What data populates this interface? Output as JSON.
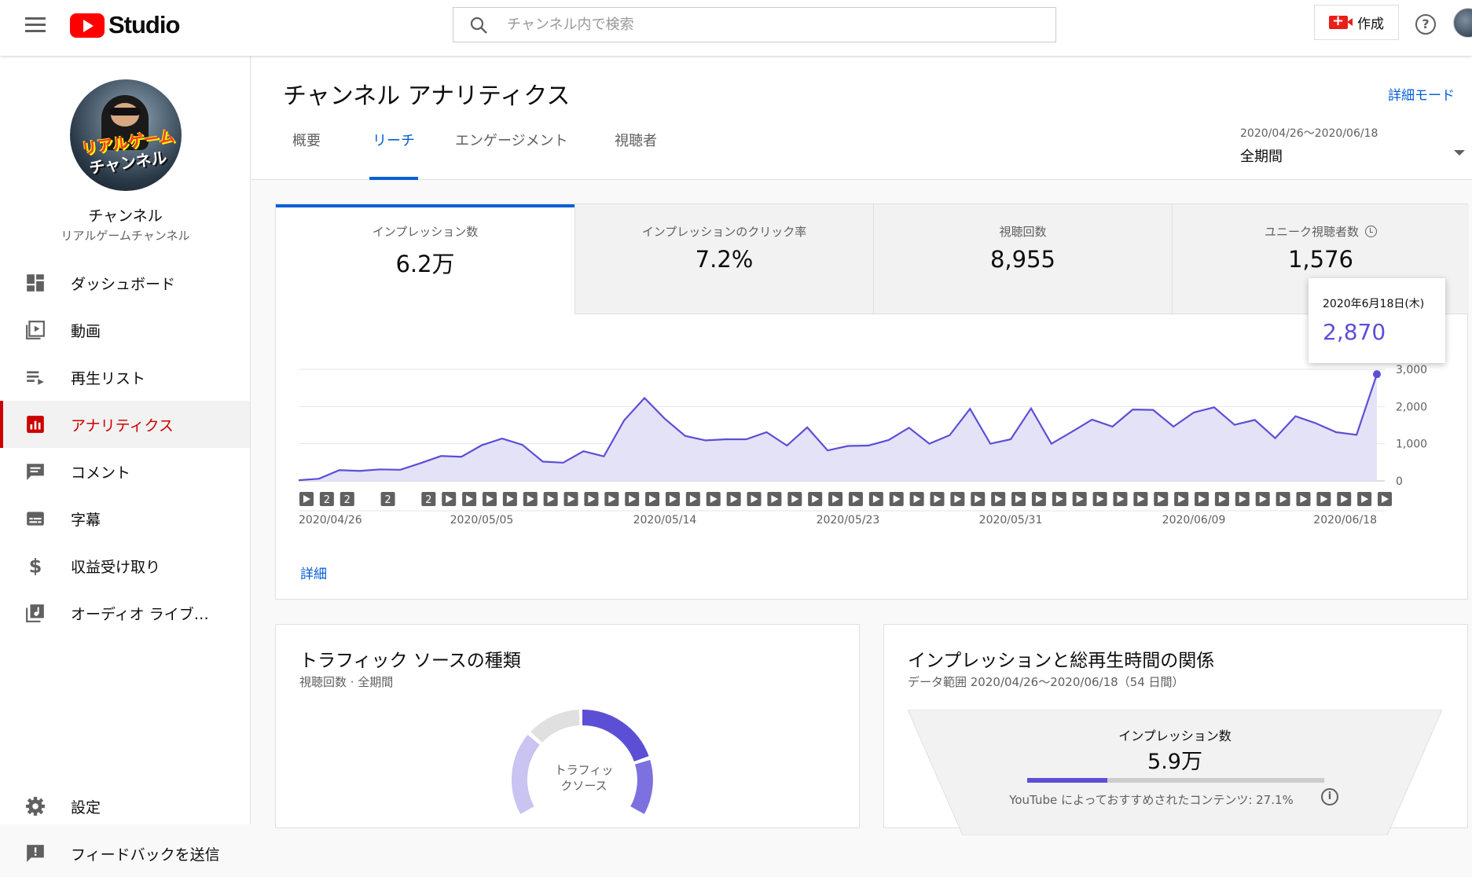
{
  "app": {
    "logo_text": "Studio",
    "logo_color": "#ff0000"
  },
  "search": {
    "placeholder": "チャンネル内で検索"
  },
  "header": {
    "create_label": "作成",
    "help_label": "?"
  },
  "channel": {
    "name": "チャンネル",
    "handle": "リアルゲームチャンネル",
    "avatar_text_1": "リアルゲーム",
    "avatar_text_2": "チャンネル"
  },
  "sidebar": {
    "items": [
      {
        "label": "ダッシュボード",
        "icon": "dashboard-icon"
      },
      {
        "label": "動画",
        "icon": "video-icon"
      },
      {
        "label": "再生リスト",
        "icon": "playlist-icon"
      },
      {
        "label": "アナリティクス",
        "icon": "analytics-icon",
        "active": true
      },
      {
        "label": "コメント",
        "icon": "comment-icon"
      },
      {
        "label": "字幕",
        "icon": "subtitles-icon"
      },
      {
        "label": "収益受け取り",
        "icon": "dollar-icon"
      },
      {
        "label": "オーディオ ライブ…",
        "icon": "audio-library-icon"
      }
    ],
    "bottom_items": [
      {
        "label": "設定",
        "icon": "gear-icon"
      },
      {
        "label": "フィードバックを送信",
        "icon": "feedback-icon"
      }
    ]
  },
  "page": {
    "title": "チャンネル アナリティクス",
    "detail_mode": "詳細モード",
    "tabs": [
      {
        "label": "概要"
      },
      {
        "label": "リーチ",
        "active": true
      },
      {
        "label": "エンゲージメント"
      },
      {
        "label": "視聴者"
      }
    ],
    "period_range": "2020/04/26〜2020/06/18",
    "period_value": "全期間"
  },
  "metrics": [
    {
      "label": "インプレッション数",
      "value": "6.2万",
      "active": true
    },
    {
      "label": "インプレッションのクリック率",
      "value": "7.2%"
    },
    {
      "label": "視聴回数",
      "value": "8,955"
    },
    {
      "label": "ユニーク視聴者数",
      "value": "1,576",
      "icon": "clock-icon"
    }
  ],
  "tooltip": {
    "date": "2020年6月18日(木)",
    "value": "2,870"
  },
  "detail_link": "詳細",
  "chart_data": {
    "type": "area",
    "x_ticks": [
      "2020/04/26",
      "2020/05/05",
      "2020/05/14",
      "2020/05/23",
      "2020/05/31",
      "2020/06/09",
      "2020/06/18"
    ],
    "y_ticks": [
      "0",
      "1,000",
      "2,000",
      "3,000"
    ],
    "ylim": [
      0,
      3000
    ],
    "grid": true,
    "color": "#5c4fd6",
    "fill": "#e4e2f7",
    "values": [
      20,
      60,
      290,
      270,
      310,
      300,
      480,
      670,
      650,
      960,
      1140,
      970,
      520,
      490,
      800,
      660,
      1630,
      2230,
      1670,
      1210,
      1090,
      1120,
      1120,
      1310,
      950,
      1440,
      820,
      940,
      950,
      1100,
      1430,
      1000,
      1230,
      1940,
      1000,
      1120,
      1950,
      1000,
      1320,
      1650,
      1460,
      1920,
      1910,
      1460,
      1840,
      1980,
      1510,
      1640,
      1150,
      1740,
      1550,
      1310,
      1240,
      2870
    ],
    "marker_labels": [
      "▶",
      "2",
      "2",
      "",
      "2",
      "",
      "2",
      "▶"
    ]
  },
  "traffic_card": {
    "title": "トラフィック ソースの種類",
    "subtitle": "視聴回数 · 全期間",
    "donut_label": "トラフィックソース"
  },
  "funnel_card": {
    "title": "インプレッションと総再生時間の関係",
    "subtitle": "データ範囲 2020/04/26〜2020/06/18（54 日間）",
    "label": "インプレッション数",
    "value": "5.9万",
    "note": "YouTube によっておすすめされたコンテンツ: 27.1%",
    "bar_fraction": 0.271
  }
}
